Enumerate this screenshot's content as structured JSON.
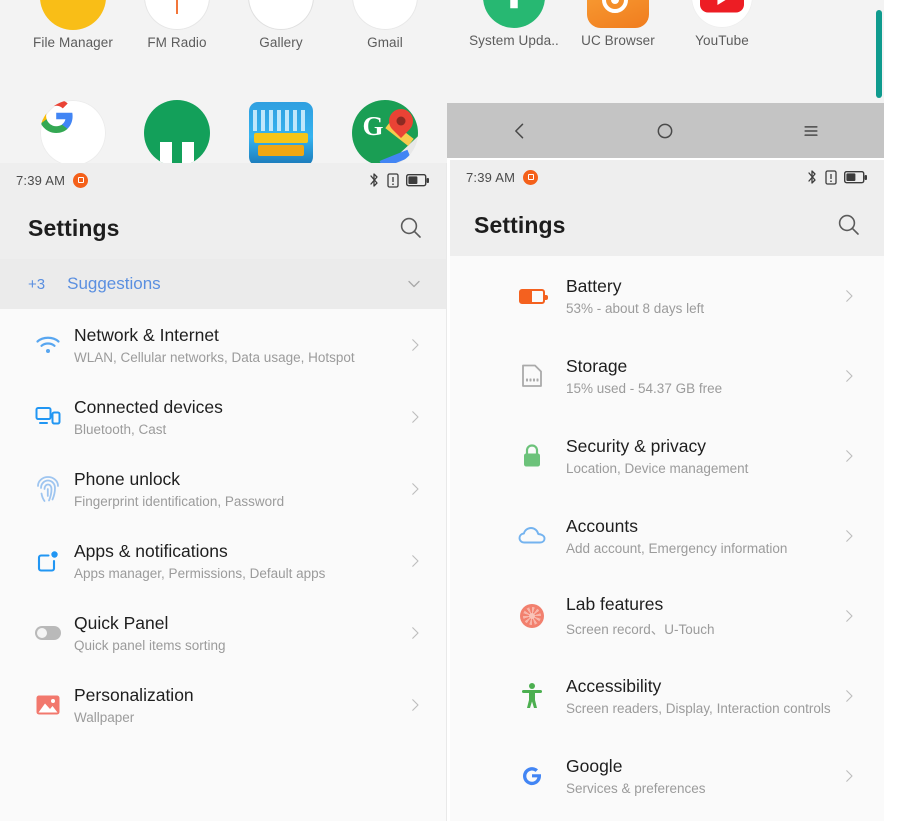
{
  "home_left": {
    "row1": [
      {
        "label": "File Manager",
        "icon": "file-manager-icon"
      },
      {
        "label": "FM Radio",
        "icon": "fm-radio-icon"
      },
      {
        "label": "Gallery",
        "icon": "gallery-icon"
      },
      {
        "label": "Gmail",
        "icon": "gmail-icon"
      }
    ],
    "row2": [
      {
        "label": "",
        "icon": "google-icon"
      },
      {
        "label": "",
        "icon": "green-app-icon"
      },
      {
        "label": "",
        "icon": "little-big-city-icon"
      },
      {
        "label": "",
        "icon": "google-maps-icon"
      }
    ]
  },
  "home_right": {
    "row1": [
      {
        "label": "System Upda..",
        "icon": "system-update-icon"
      },
      {
        "label": "UC Browser",
        "icon": "uc-browser-icon"
      },
      {
        "label": "YouTube",
        "icon": "youtube-icon"
      }
    ]
  },
  "navbar": {
    "back_label": "Back",
    "home_label": "Home",
    "recents_label": "Recent apps"
  },
  "status_bar": {
    "time": "7:39 AM",
    "notification_icon": "screenshot-notification-icon",
    "bluetooth_icon": "bluetooth-icon",
    "sim_icon": "sim-alert-icon",
    "battery_icon": "battery-icon"
  },
  "settings_left": {
    "title": "Settings",
    "search_icon": "search-icon",
    "suggestions": {
      "count": "+3",
      "label": "Suggestions",
      "expand_icon": "chevron-down-icon"
    },
    "items": [
      {
        "title": "Network & Internet",
        "subtitle": "WLAN, Cellular networks, Data usage, Hotspot",
        "icon": "wifi-icon",
        "color": "#4a90e2"
      },
      {
        "title": "Connected devices",
        "subtitle": "Bluetooth, Cast",
        "icon": "connected-devices-icon",
        "color": "#2196f3"
      },
      {
        "title": "Phone unlock",
        "subtitle": "Fingerprint identification, Password",
        "icon": "fingerprint-icon",
        "color": "#9ec5f0"
      },
      {
        "title": "Apps & notifications",
        "subtitle": "Apps manager, Permissions, Default apps",
        "icon": "apps-notifications-icon",
        "color": "#2196f3"
      },
      {
        "title": "Quick Panel",
        "subtitle": "Quick panel items sorting",
        "icon": "toggle-icon",
        "color": "#b9b9b9"
      },
      {
        "title": "Personalization",
        "subtitle": "Wallpaper",
        "icon": "wallpaper-icon",
        "color": "#f2786d"
      }
    ]
  },
  "settings_right": {
    "title": "Settings",
    "search_icon": "search-icon",
    "items": [
      {
        "title": "Battery",
        "subtitle": "53% - about 8 days left",
        "icon": "battery-icon",
        "color": "#f4611f"
      },
      {
        "title": "Storage",
        "subtitle": "15% used - 54.37 GB free",
        "icon": "storage-icon",
        "color": "#9e9e9e"
      },
      {
        "title": "Security & privacy",
        "subtitle": "Location, Device management",
        "icon": "lock-icon",
        "color": "#6cc27a"
      },
      {
        "title": "Accounts",
        "subtitle": "Add account, Emergency information",
        "icon": "cloud-icon",
        "color": "#74b3ef"
      },
      {
        "title": "Lab features",
        "subtitle": "Screen record、U-Touch",
        "icon": "lab-features-icon",
        "color": "#f2806e"
      },
      {
        "title": "Accessibility",
        "subtitle": "Screen readers, Display, Interaction controls",
        "icon": "accessibility-icon",
        "color": "#4caf50"
      },
      {
        "title": "Google",
        "subtitle": "Services & preferences",
        "icon": "google-g-icon",
        "color": "#4285f4"
      }
    ]
  },
  "colors": {
    "panel_bg": "#fafafa",
    "appbar_bg": "#eeeeee",
    "suggestions_bg": "#ebebeb",
    "navbar_bg": "#c4c4c4",
    "scrollbar": "#0f9b8e",
    "accent_blue": "#5a8fe0",
    "title_text": "#1e1e1e",
    "subtitle_text": "#9b9b9b"
  }
}
